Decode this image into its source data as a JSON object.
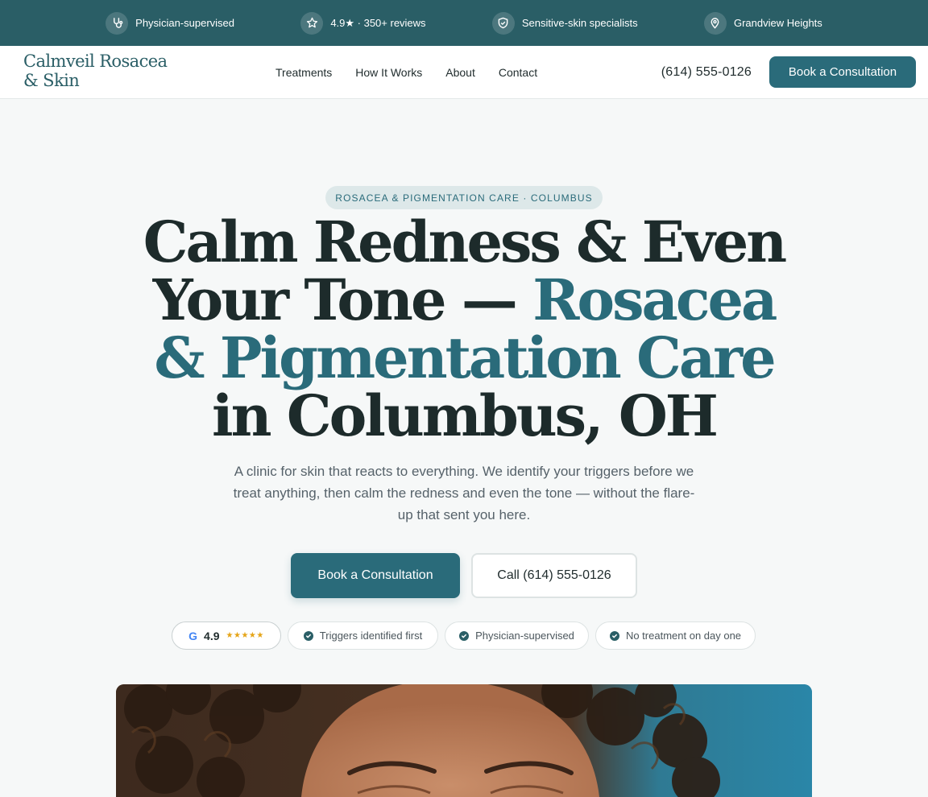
{
  "topbar": {
    "items": [
      {
        "icon": "stethoscope-icon",
        "label": "Physician-supervised"
      },
      {
        "icon": "star-icon",
        "label": "4.9★ · 350+ reviews"
      },
      {
        "icon": "shield-icon",
        "label": "Sensitive-skin specialists"
      },
      {
        "icon": "location-pin-icon",
        "label": "Grandview Heights"
      }
    ]
  },
  "nav": {
    "logo_line1": "Calmveil Rosacea",
    "logo_line2": "& Skin",
    "links": [
      "Treatments",
      "How It Works",
      "About",
      "Contact"
    ],
    "phone": "(614) 555-0126",
    "cta": "Book a Consultation"
  },
  "hero": {
    "eyebrow": "ROSACEA & PIGMENTATION CARE · COLUMBUS",
    "headline_line1": "Calm Redness & Even",
    "headline_line2_plain": "Your Tone — ",
    "headline_line2_accent": "Rosacea",
    "headline_line3_accent": "& Pigmentation Care",
    "headline_line4": "in Columbus, OH",
    "subhead": "A clinic for skin that reacts to everything. We identify your triggers before we treat anything, then calm the redness and even the tone — without the flare-up that sent you here.",
    "primary_cta": "Book a Consultation",
    "secondary_cta": "Call (614) 555-0126",
    "rating": {
      "letter": "G",
      "value": "4.9",
      "stars": "★★★★★"
    },
    "badges": [
      "Triggers identified first",
      "Physician-supervised",
      "No treatment on day one"
    ]
  },
  "colors": {
    "brand": "#2a6b7a",
    "topbar": "#2a5e66",
    "stars": "#e5a417"
  }
}
